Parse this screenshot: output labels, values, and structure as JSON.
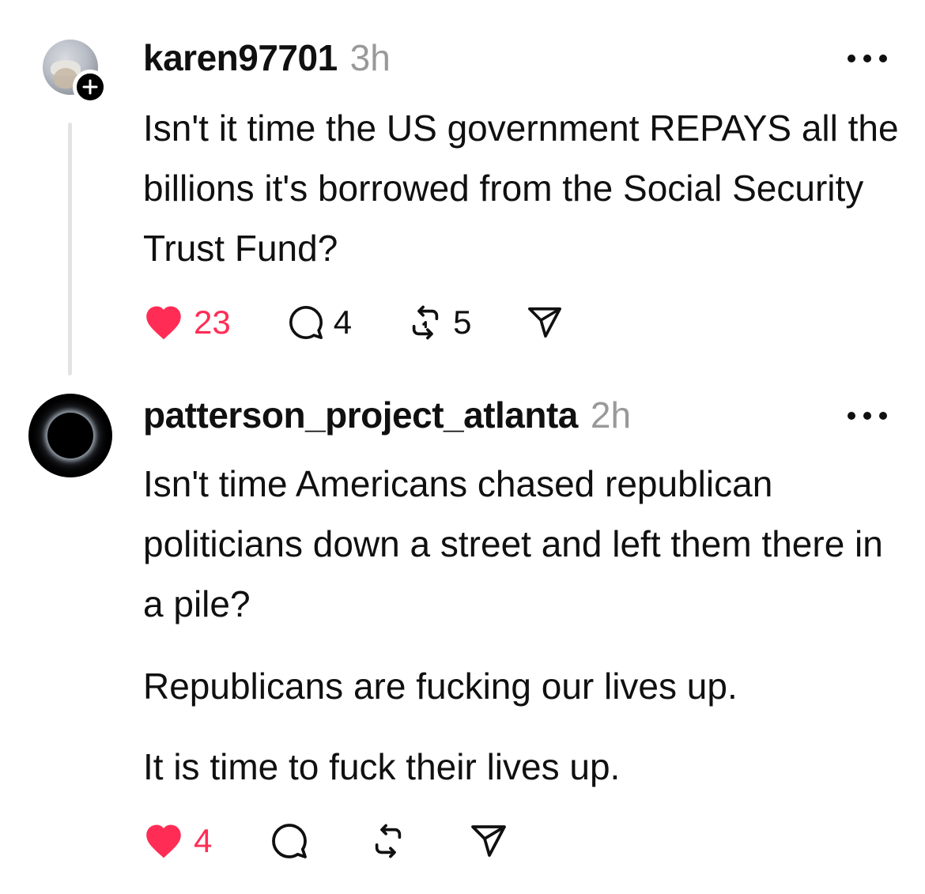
{
  "posts": [
    {
      "username": "karen97701",
      "time": "3h",
      "body": "Isn't it time the US government REPAYS all the billions it's borrowed from the Social Security Trust Fund?",
      "likes": "23",
      "replies": "4",
      "reposts": "5",
      "liked": true,
      "follow_badge": "+"
    },
    {
      "username": "patterson_project_atlanta",
      "time": "2h",
      "paragraphs": [
        "Isn't time Americans chased republican politicians down a street and left them there in a pile?",
        "Republicans are fucking our lives up.",
        "It is time to fuck their lives up."
      ],
      "likes": "4",
      "liked": true
    }
  ],
  "icons": {
    "like": "heart-icon",
    "reply": "comment-icon",
    "repost": "repost-icon",
    "share": "send-icon",
    "more": "more-icon"
  },
  "colors": {
    "like": "#ff2d55",
    "text": "#101010",
    "muted": "#999999",
    "thread_line": "#e3e3e3"
  }
}
